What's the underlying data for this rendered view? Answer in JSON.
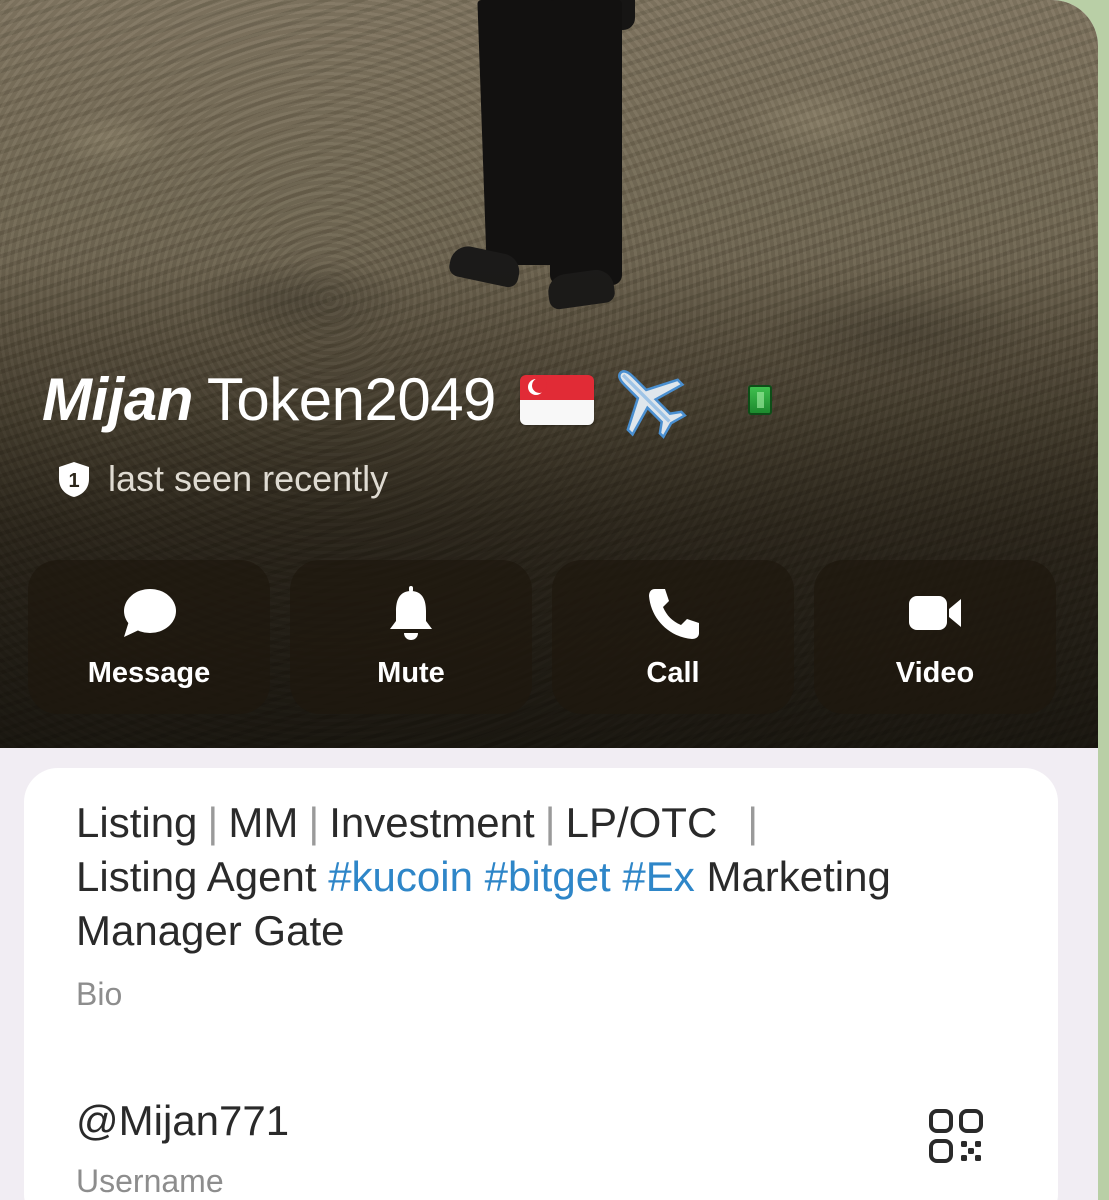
{
  "profile": {
    "name_first": "Mijan",
    "name_last": "Token2049",
    "status": "last seen recently",
    "shield_number": "1"
  },
  "actions": [
    {
      "label": "Message",
      "icon": "message-bubble-icon"
    },
    {
      "label": "Mute",
      "icon": "bell-icon"
    },
    {
      "label": "Call",
      "icon": "phone-icon"
    },
    {
      "label": "Video",
      "icon": "video-camera-icon"
    }
  ],
  "bio": {
    "items": [
      "Listing",
      "MM",
      "Investment",
      "LP/OTC"
    ],
    "line2_prefix": "Listing Agent",
    "tags": [
      "#kucoin",
      "#bitget",
      "#Ex"
    ],
    "line2_suffix": "Marketing",
    "line3": "Manager Gate",
    "label": "Bio"
  },
  "username": {
    "value": "@Mijan771",
    "label": "Username"
  },
  "colors": {
    "card_bg": "#ffffff",
    "hashtag": "#2e86c8",
    "action_bg": "rgba(30,24,14,0.72)",
    "outer_bg": "#b9cfa6"
  }
}
